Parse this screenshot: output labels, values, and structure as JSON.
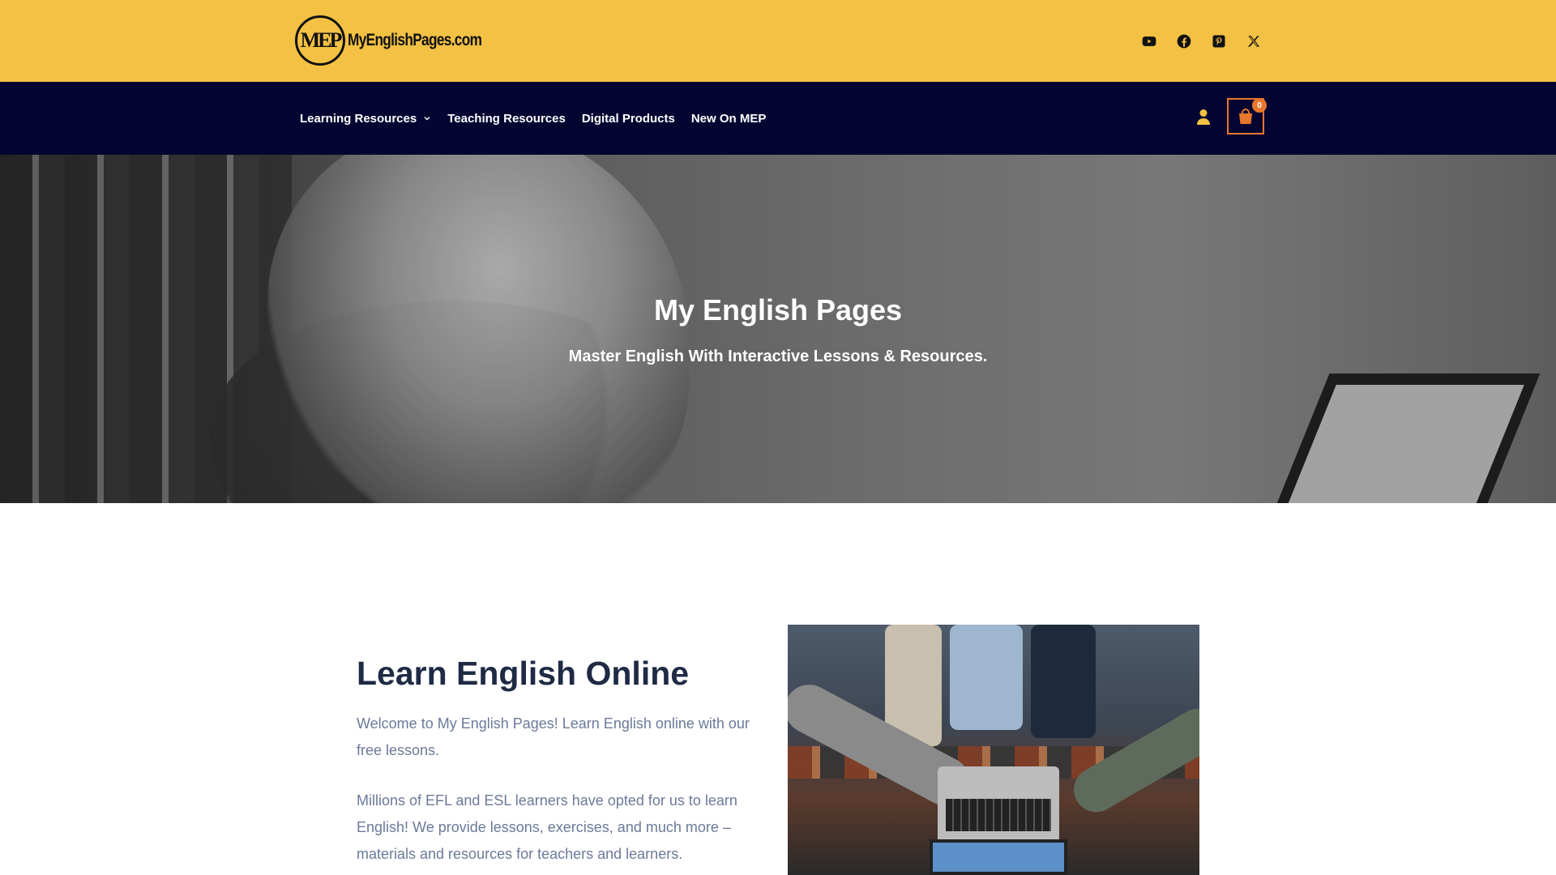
{
  "brand": {
    "logo_mark": "MEP",
    "logo_text": "MyEnglishPages.com"
  },
  "social_icons": [
    "youtube-icon",
    "facebook-icon",
    "pinterest-icon",
    "x-icon"
  ],
  "nav": {
    "items": [
      {
        "label": "Learning Resources",
        "has_dropdown": true
      },
      {
        "label": "Teaching Resources",
        "has_dropdown": false
      },
      {
        "label": "Digital Products",
        "has_dropdown": false
      },
      {
        "label": "New On MEP",
        "has_dropdown": false
      }
    ],
    "cart_count": "0"
  },
  "hero": {
    "title": "My English Pages",
    "subtitle": "Master English With Interactive Lessons & Resources."
  },
  "intro": {
    "title": "Learn English Online",
    "paragraphs": [
      "Welcome to My English Pages! Learn English online with our free lessons.",
      "Millions of EFL and ESL learners have opted for us to learn English! We provide lessons, exercises, and much more – materials and resources for teachers and learners."
    ]
  },
  "colors": {
    "topbar": "#f3c143",
    "navbar": "#050532",
    "accent": "#e8772e",
    "heading": "#1f2a44",
    "body_text": "#6b7a99"
  }
}
